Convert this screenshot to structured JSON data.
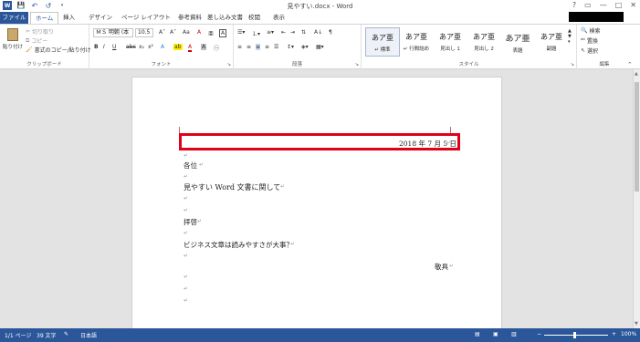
{
  "window": {
    "title": "見やすい.docx - Word",
    "help": "?",
    "minimize": "—",
    "maximize": "□",
    "close": "✕"
  },
  "qat": {
    "save": "💾",
    "undo": "↶",
    "redo": "↺"
  },
  "tabs": [
    "ファイル",
    "ホーム",
    "挿入",
    "デザイン",
    "ページ レイアウト",
    "参考資料",
    "差し込み文書",
    "校閲",
    "表示"
  ],
  "clipboard": {
    "paste": "貼り付け",
    "cut": "切り取り",
    "copy": "コピー",
    "format_painter": "書式のコピー/貼り付け",
    "label": "クリップボード"
  },
  "font": {
    "name": "ＭＳ 明朝 (本",
    "size": "10.5",
    "grow": "A˄",
    "shrink": "A˅",
    "case": "Aa",
    "clear": "A",
    "bold": "B",
    "italic": "I",
    "underline": "U",
    "strike": "abc",
    "sub": "x₂",
    "sup": "x²",
    "effects": "A",
    "highlight": "ab",
    "color": "A",
    "shade": "A",
    "border": "A",
    "label": "フォント"
  },
  "paragraph": {
    "label": "段落",
    "sort": "A↓",
    "marks": "¶"
  },
  "styles": {
    "label": "スタイル",
    "items": [
      {
        "sample": "あア亜",
        "name": "↵ 標準"
      },
      {
        "sample": "あア亜",
        "name": "↵ 行間詰め"
      },
      {
        "sample": "あア亜",
        "name": "見出し 1"
      },
      {
        "sample": "あア亜",
        "name": "見出し 2"
      },
      {
        "sample": "あア亜",
        "name": "表題"
      },
      {
        "sample": "あア亜",
        "name": "副題"
      }
    ]
  },
  "editing": {
    "find": "検索",
    "replace": "置換",
    "select": "選択",
    "label": "編集"
  },
  "document": {
    "date": "2018 年 7 月 5 日",
    "to": "各位",
    "subject": "見やすい Word 文書に関して",
    "greeting": "拝啓",
    "body": "ビジネス文章は読みやすさが大事？",
    "closing": "敬具",
    "para_mark": "↵"
  },
  "status": {
    "page": "1/1 ページ",
    "words": "39 文字",
    "language": "日本語",
    "zoom_minus": "−",
    "zoom_plus": "+",
    "zoom": "100%"
  },
  "colors": {
    "accent": "#2b579a",
    "highlight_box": "#e0001a"
  }
}
